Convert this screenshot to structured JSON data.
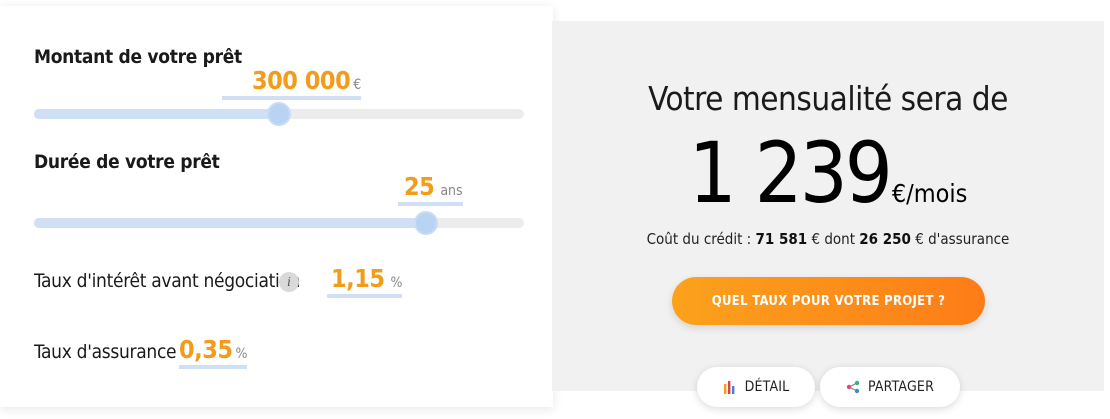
{
  "loan_amount": {
    "label": "Montant de votre prêt",
    "value": "300 000",
    "unit": "€",
    "slider_fraction": 0.5
  },
  "loan_duration": {
    "label": "Durée de votre prêt",
    "value": "25",
    "unit": "ans",
    "slider_fraction": 0.8
  },
  "interest_rate": {
    "label": "Taux d'intérêt avant négociation",
    "info_glyph": "i",
    "value": "1,15",
    "unit": "%"
  },
  "insurance_rate": {
    "label": "Taux d'assurance",
    "value": "0,35",
    "unit": "%"
  },
  "result": {
    "title": "Votre mensualité sera de",
    "amount": "1 239",
    "amount_unit": "€/mois",
    "cost_prefix": "Coût du crédit : ",
    "cost_total": "71 581",
    "cost_mid": " € dont ",
    "cost_insurance": "26 250",
    "cost_suffix": " € d'assurance"
  },
  "cta": {
    "label": "QUEL TAUX POUR VOTRE PROJET ?"
  },
  "actions": {
    "detail_label": "DÉTAIL",
    "share_label": "PARTAGER"
  },
  "colors": {
    "accent_orange": "#f39c1a",
    "cta_start": "#fba21c",
    "cta_end": "#fd7c18",
    "slider_blue": "#cfe0f5",
    "panel_gray": "#f1f1f1"
  },
  "icons": {
    "detail": "bar-chart-icon",
    "share": "share-icon",
    "info": "info-icon"
  }
}
